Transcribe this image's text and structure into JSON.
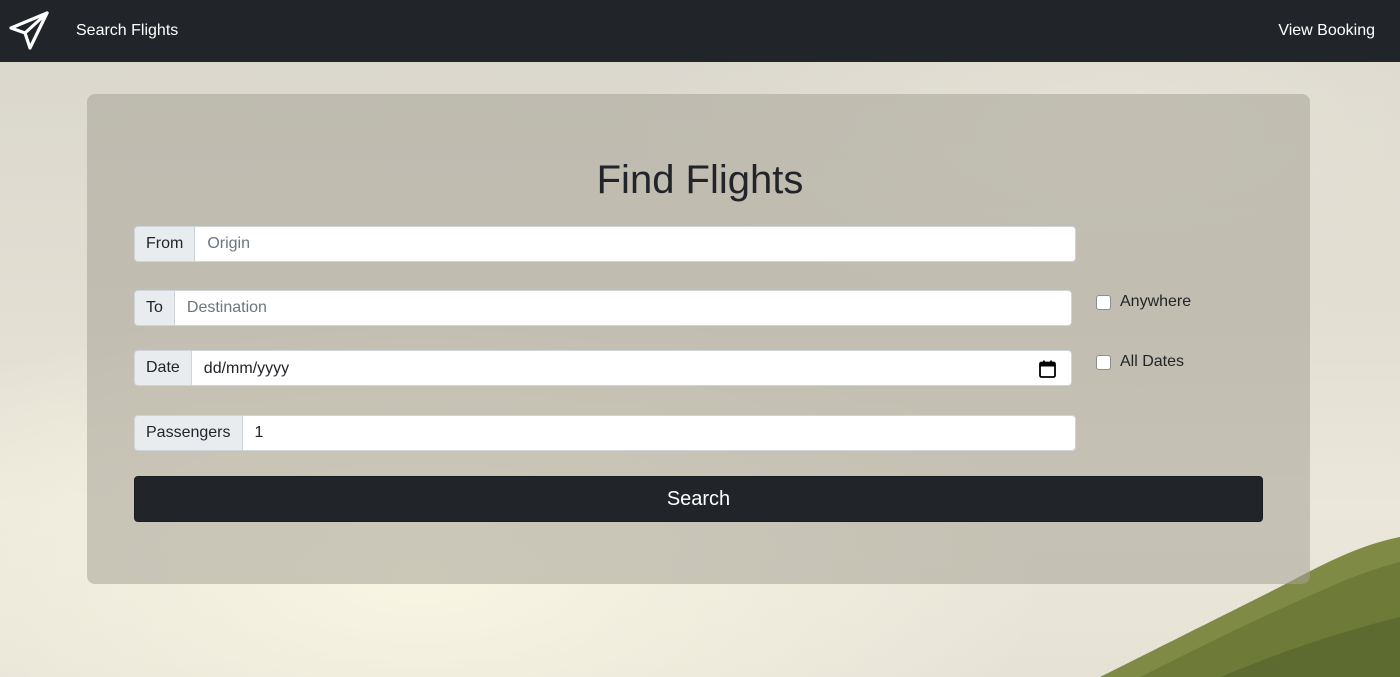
{
  "navbar": {
    "brand_icon": "paper-plane-icon",
    "search_link": "Search Flights",
    "booking_link": "View Booking"
  },
  "form": {
    "title": "Find Flights",
    "from": {
      "label": "From",
      "placeholder": "Origin"
    },
    "to": {
      "label": "To",
      "placeholder": "Destination"
    },
    "date": {
      "label": "Date",
      "value": "dd/mm/yyyy",
      "icon": "calendar-icon"
    },
    "passengers": {
      "label": "Passengers",
      "value": "1"
    },
    "anywhere_label": "Anywhere",
    "all_dates_label": "All Dates",
    "search_button": "Search"
  },
  "colors": {
    "navbar_bg": "#212529",
    "button_bg": "#212529",
    "addon_bg": "#e9ecef"
  }
}
